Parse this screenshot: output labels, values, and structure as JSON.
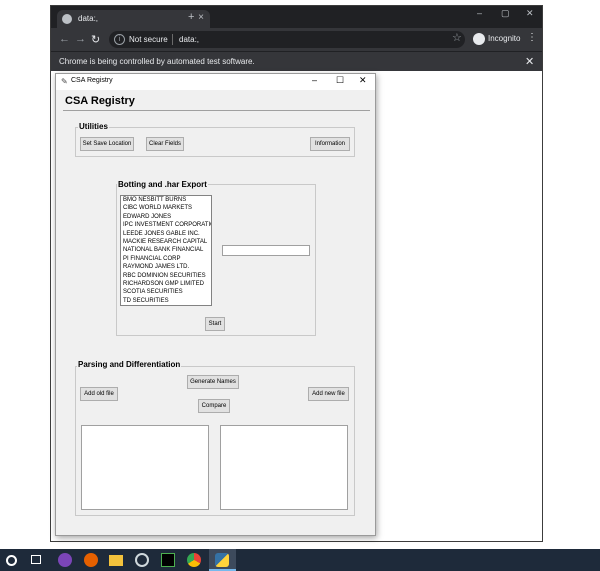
{
  "browser": {
    "tab_title": "data:,",
    "new_tab": "+",
    "tab_close": "×",
    "controls": {
      "minimize": "–",
      "maximize": "▢",
      "close": "✕"
    },
    "nav": {
      "back": "←",
      "forward": "→",
      "reload": "↻"
    },
    "security_label": "Not secure",
    "url": "data:,",
    "bookmark_star": "☆",
    "incognito_label": "Incognito",
    "menu": "⋮",
    "infobar_text": "Chrome is being controlled by automated test software.",
    "infobar_close": "✕"
  },
  "app": {
    "window_title": "CSA Registry",
    "heading": "CSA Registry",
    "controls": {
      "minimize": "–",
      "maximize": "☐",
      "close": "✕"
    },
    "utilities": {
      "label": "Utilities",
      "set_save_location": "Set Save Location",
      "clear_fields": "Clear Fields",
      "information": "Information"
    },
    "botting": {
      "label": "Botting and .har Export",
      "list_items": [
        "BMO NESBITT BURNS",
        "CIBC WORLD MARKETS",
        "EDWARD JONES",
        "IPC INVESTMENT CORPORATIO",
        "LEEDE JONES GABLE INC.",
        "MACKIE RESEARCH CAPITAL",
        "NATIONAL BANK FINANCIAL",
        "PI FINANCIAL CORP",
        "RAYMOND JAMES LTD.",
        "RBC DOMINION SECURITIES",
        "RICHARDSON GMP LIMITED",
        "SCOTIA SECURITIES",
        "TD SECURITIES"
      ],
      "start": "Start",
      "entry_value": ""
    },
    "parsing": {
      "label": "Parsing and Differentiation",
      "generate_names": "Generate Names",
      "add_old_file": "Add old file",
      "add_new_file": "Add new file",
      "compare": "Compare"
    }
  },
  "taskbar": {
    "icons": [
      "start-icon",
      "search-icon",
      "task-view-icon",
      "tor-browser-icon",
      "firefox-icon",
      "file-explorer-icon",
      "app-icon",
      "terminal-icon",
      "chrome-icon",
      "python-icon"
    ]
  }
}
